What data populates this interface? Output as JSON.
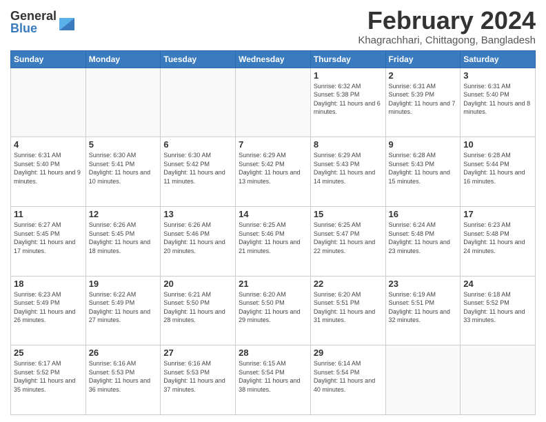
{
  "header": {
    "logo_general": "General",
    "logo_blue": "Blue",
    "month_title": "February 2024",
    "location": "Khagrachhari, Chittagong, Bangladesh"
  },
  "days_of_week": [
    "Sunday",
    "Monday",
    "Tuesday",
    "Wednesday",
    "Thursday",
    "Friday",
    "Saturday"
  ],
  "weeks": [
    [
      {
        "day": "",
        "info": ""
      },
      {
        "day": "",
        "info": ""
      },
      {
        "day": "",
        "info": ""
      },
      {
        "day": "",
        "info": ""
      },
      {
        "day": "1",
        "info": "Sunrise: 6:32 AM\nSunset: 5:38 PM\nDaylight: 11 hours and 6 minutes."
      },
      {
        "day": "2",
        "info": "Sunrise: 6:31 AM\nSunset: 5:39 PM\nDaylight: 11 hours and 7 minutes."
      },
      {
        "day": "3",
        "info": "Sunrise: 6:31 AM\nSunset: 5:40 PM\nDaylight: 11 hours and 8 minutes."
      }
    ],
    [
      {
        "day": "4",
        "info": "Sunrise: 6:31 AM\nSunset: 5:40 PM\nDaylight: 11 hours and 9 minutes."
      },
      {
        "day": "5",
        "info": "Sunrise: 6:30 AM\nSunset: 5:41 PM\nDaylight: 11 hours and 10 minutes."
      },
      {
        "day": "6",
        "info": "Sunrise: 6:30 AM\nSunset: 5:42 PM\nDaylight: 11 hours and 11 minutes."
      },
      {
        "day": "7",
        "info": "Sunrise: 6:29 AM\nSunset: 5:42 PM\nDaylight: 11 hours and 13 minutes."
      },
      {
        "day": "8",
        "info": "Sunrise: 6:29 AM\nSunset: 5:43 PM\nDaylight: 11 hours and 14 minutes."
      },
      {
        "day": "9",
        "info": "Sunrise: 6:28 AM\nSunset: 5:43 PM\nDaylight: 11 hours and 15 minutes."
      },
      {
        "day": "10",
        "info": "Sunrise: 6:28 AM\nSunset: 5:44 PM\nDaylight: 11 hours and 16 minutes."
      }
    ],
    [
      {
        "day": "11",
        "info": "Sunrise: 6:27 AM\nSunset: 5:45 PM\nDaylight: 11 hours and 17 minutes."
      },
      {
        "day": "12",
        "info": "Sunrise: 6:26 AM\nSunset: 5:45 PM\nDaylight: 11 hours and 18 minutes."
      },
      {
        "day": "13",
        "info": "Sunrise: 6:26 AM\nSunset: 5:46 PM\nDaylight: 11 hours and 20 minutes."
      },
      {
        "day": "14",
        "info": "Sunrise: 6:25 AM\nSunset: 5:46 PM\nDaylight: 11 hours and 21 minutes."
      },
      {
        "day": "15",
        "info": "Sunrise: 6:25 AM\nSunset: 5:47 PM\nDaylight: 11 hours and 22 minutes."
      },
      {
        "day": "16",
        "info": "Sunrise: 6:24 AM\nSunset: 5:48 PM\nDaylight: 11 hours and 23 minutes."
      },
      {
        "day": "17",
        "info": "Sunrise: 6:23 AM\nSunset: 5:48 PM\nDaylight: 11 hours and 24 minutes."
      }
    ],
    [
      {
        "day": "18",
        "info": "Sunrise: 6:23 AM\nSunset: 5:49 PM\nDaylight: 11 hours and 26 minutes."
      },
      {
        "day": "19",
        "info": "Sunrise: 6:22 AM\nSunset: 5:49 PM\nDaylight: 11 hours and 27 minutes."
      },
      {
        "day": "20",
        "info": "Sunrise: 6:21 AM\nSunset: 5:50 PM\nDaylight: 11 hours and 28 minutes."
      },
      {
        "day": "21",
        "info": "Sunrise: 6:20 AM\nSunset: 5:50 PM\nDaylight: 11 hours and 29 minutes."
      },
      {
        "day": "22",
        "info": "Sunrise: 6:20 AM\nSunset: 5:51 PM\nDaylight: 11 hours and 31 minutes."
      },
      {
        "day": "23",
        "info": "Sunrise: 6:19 AM\nSunset: 5:51 PM\nDaylight: 11 hours and 32 minutes."
      },
      {
        "day": "24",
        "info": "Sunrise: 6:18 AM\nSunset: 5:52 PM\nDaylight: 11 hours and 33 minutes."
      }
    ],
    [
      {
        "day": "25",
        "info": "Sunrise: 6:17 AM\nSunset: 5:52 PM\nDaylight: 11 hours and 35 minutes."
      },
      {
        "day": "26",
        "info": "Sunrise: 6:16 AM\nSunset: 5:53 PM\nDaylight: 11 hours and 36 minutes."
      },
      {
        "day": "27",
        "info": "Sunrise: 6:16 AM\nSunset: 5:53 PM\nDaylight: 11 hours and 37 minutes."
      },
      {
        "day": "28",
        "info": "Sunrise: 6:15 AM\nSunset: 5:54 PM\nDaylight: 11 hours and 38 minutes."
      },
      {
        "day": "29",
        "info": "Sunrise: 6:14 AM\nSunset: 5:54 PM\nDaylight: 11 hours and 40 minutes."
      },
      {
        "day": "",
        "info": ""
      },
      {
        "day": "",
        "info": ""
      }
    ]
  ]
}
